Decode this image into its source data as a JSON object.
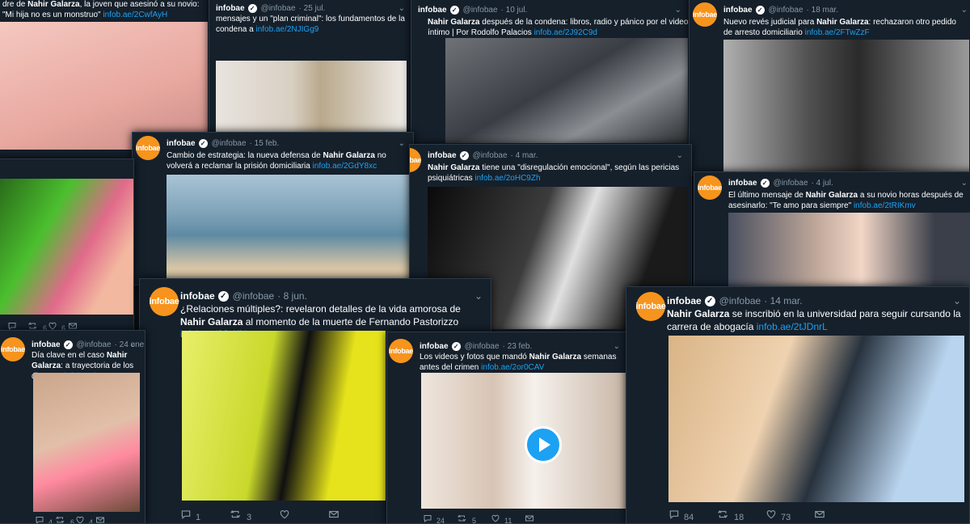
{
  "brand": {
    "account_name": "infobae",
    "handle": "@infobae",
    "avatar_text": "infobae",
    "avatar_color": "#f7941d",
    "link_color": "#1da1f2",
    "bg_color": "#15202b"
  },
  "icons": {
    "reply": "reply-icon",
    "retweet": "retweet-icon",
    "like": "like-icon",
    "dm": "envelope-icon",
    "verified": "verified-icon",
    "chevron": "chevron-down-icon",
    "play": "play-icon"
  },
  "tweets": [
    {
      "date": "",
      "pre": "dre de ",
      "bold": "Nahir Galarza",
      "post": ", la joven que asesinó a su novio: \"Mi hija no es un monstruo\"",
      "link": "infob.ae/2CwfAyH",
      "counts": {
        "reply": "",
        "retweet": "8",
        "like": "18",
        "dm": ""
      }
    },
    {
      "date": "25 jul.",
      "pre": "mensajes y un \"plan criminal\": los fundamentos de la condena a ",
      "bold": "",
      "post": "",
      "link": "infob.ae/2NJIGg9",
      "counts": {
        "reply": "",
        "retweet": "",
        "like": "",
        "dm": ""
      }
    },
    {
      "date": "10 jul.",
      "pre": "",
      "bold": "Nahir Galarza",
      "post": " después de la condena: libros, radio y pánico por el video íntimo | Por Rodolfo Palacios",
      "link": "infob.ae/2J92C9d",
      "counts": {
        "reply": "",
        "retweet": "",
        "like": "",
        "dm": ""
      }
    },
    {
      "date": "18 mar.",
      "pre": "Nuevo revés judicial para ",
      "bold": "Nahir Galarza",
      "post": ": rechazaron otro pedido de arresto domiciliario",
      "link": "infob.ae/2FTwZzF",
      "counts": {
        "reply": "",
        "retweet": "",
        "like": "",
        "dm": ""
      }
    },
    {
      "date": "15 feb.",
      "pre": "Cambio de estrategia: la nueva defensa de ",
      "bold": "Nahir Galarza",
      "post": " no volverá a reclamar la prisión domiciliaria",
      "link": "infob.ae/2GdY8xc",
      "counts": {
        "reply": "",
        "retweet": "",
        "like": "",
        "dm": ""
      }
    },
    {
      "date": "4 mar.",
      "pre": "",
      "bold": "Nahir Galarza",
      "post": " tiene una \"disregulación emocional\", según las pericias psiquiátricas",
      "link": "infob.ae/2oHC9Zh",
      "counts": {
        "reply": "",
        "retweet": "",
        "like": "",
        "dm": ""
      }
    },
    {
      "date": "4 jul.",
      "pre": "El último mensaje de ",
      "bold": "Nahir Galarza",
      "post": " a su novio horas después de asesinarlo: \"Te amo para siempre\"",
      "link": "infob.ae/2tRIKmv",
      "counts": {
        "reply": "",
        "retweet": "",
        "like": "",
        "dm": ""
      }
    },
    {
      "date": "",
      "pre": "",
      "bold": "",
      "post": "",
      "link": "",
      "counts": {
        "reply": "",
        "retweet": "6",
        "like": "6",
        "dm": ""
      }
    },
    {
      "date": "8 jun.",
      "pre": "¿Relaciones múltiples?: revelaron detalles de la vida amorosa de ",
      "bold": "Nahir Galarza",
      "post": " al momento de la muerte de Fernando Pastorizzo",
      "link": "infob.ae/2JpKNnx",
      "counts": {
        "reply": "1",
        "retweet": "3",
        "like": "",
        "dm": ""
      }
    },
    {
      "date": "24 ene.",
      "pre": "Día clave en el caso ",
      "bold": "Nahir Galarza",
      "post": ": a trayectoria de los disparos",
      "link": "infob.ae/2",
      "counts": {
        "reply": "4",
        "retweet": "6",
        "like": "4",
        "dm": ""
      }
    },
    {
      "date": "23 feb.",
      "pre": "Los videos y fotos que mandó ",
      "bold": "Nahir Galarza",
      "post": " semanas antes del crimen",
      "link": "infob.ae/2or0CAV",
      "counts": {
        "reply": "24",
        "retweet": "5",
        "like": "11",
        "dm": ""
      }
    },
    {
      "date": "14 mar.",
      "pre": "",
      "bold": "Nahir Galarza",
      "post": " se inscribió en la universidad para seguir cursando la carrera de abogacía",
      "link": "infob.ae/2tJDnrL",
      "counts": {
        "reply": "84",
        "retweet": "18",
        "like": "73",
        "dm": ""
      }
    }
  ]
}
